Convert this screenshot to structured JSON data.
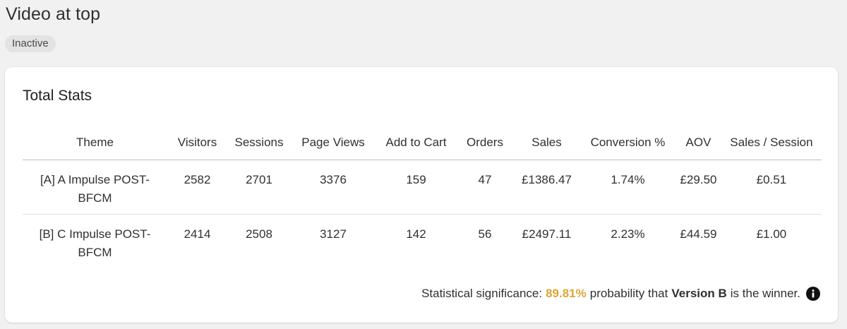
{
  "header": {
    "title": "Video at top",
    "status": "Inactive"
  },
  "card": {
    "title": "Total Stats"
  },
  "table": {
    "columns": [
      "Theme",
      "Visitors",
      "Sessions",
      "Page Views",
      "Add to Cart",
      "Orders",
      "Sales",
      "Conversion %",
      "AOV",
      "Sales / Session"
    ],
    "rows": [
      {
        "theme_line1": "[A] A Impulse POST-",
        "theme_line2": "BFCM",
        "visitors": "2582",
        "sessions": "2701",
        "page_views": "3376",
        "add_to_cart": "159",
        "orders": "47",
        "sales": "£1386.47",
        "conversion": "1.74%",
        "aov": "£29.50",
        "sales_per_session": "£0.51"
      },
      {
        "theme_line1": "[B] C Impulse POST-",
        "theme_line2": "BFCM",
        "visitors": "2414",
        "sessions": "2508",
        "page_views": "3127",
        "add_to_cart": "142",
        "orders": "56",
        "sales": "£2497.11",
        "conversion": "2.23%",
        "aov": "£44.59",
        "sales_per_session": "£1.00"
      }
    ]
  },
  "significance": {
    "prefix": "Statistical significance:",
    "percent": "89.81%",
    "middle": "probability that",
    "winner": "Version B",
    "suffix": "is the winner.",
    "percent_color": "#e0a43a",
    "icon": "info-icon"
  }
}
